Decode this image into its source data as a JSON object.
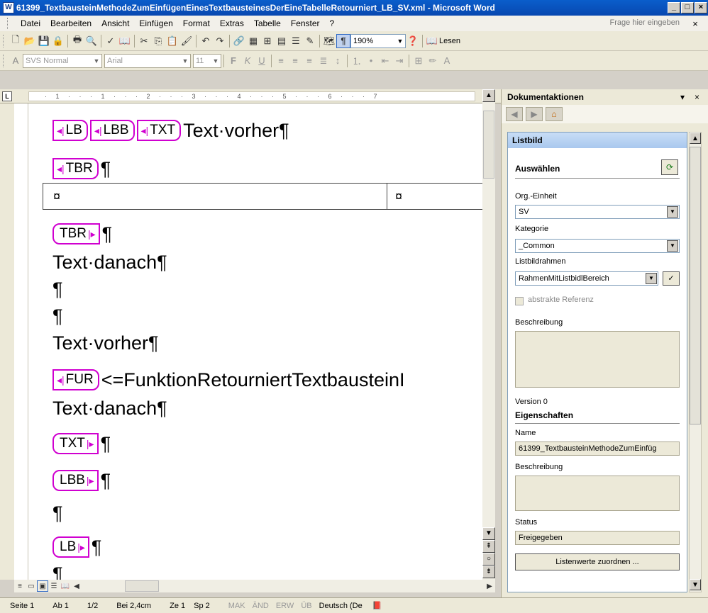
{
  "window": {
    "title": "61399_TextbausteinMethodeZumEinfügenEinesTextbausteinesDerEineTabelleRetourniert_LB_SV.xml - Microsoft Word",
    "min": "_",
    "max": "□",
    "close": "×"
  },
  "menu": {
    "items": [
      "Datei",
      "Bearbeiten",
      "Ansicht",
      "Einfügen",
      "Format",
      "Extras",
      "Tabelle",
      "Fenster",
      "?"
    ],
    "help_placeholder": "Frage hier eingeben",
    "close": "×"
  },
  "toolbar": {
    "zoom": "190%",
    "read": "Lesen"
  },
  "format": {
    "style": "SVS Normal",
    "font": "Arial",
    "size": "11"
  },
  "ruler": {
    "marks": "· 1 · · · 1 · · · 2 · · · 3 · · · 4 · · · 5 · · · 6 · · · 7"
  },
  "doc": {
    "tags": {
      "lb": "LB",
      "lbb": "LBB",
      "txt": "TXT",
      "tbr": "TBR",
      "fur": "FUR",
      "txt_end": "TXT",
      "lbb_end": "LBB",
      "lb_end": "LB",
      "tbr_end": "TBR"
    },
    "lines": {
      "l1": "Text·vorher¶",
      "l2": "¶",
      "cell1": "¤",
      "cell2": "¤",
      "l3": "¶",
      "l4": "Text·danach¶",
      "l5": "¶",
      "l6": "¶",
      "l7": "Text·vorher¶",
      "l8": "<=FunktionRetourniertTextbausteinI",
      "l9": "Text·danach¶",
      "l10": "¶",
      "l11": "¶",
      "l12": "¶",
      "l13": "¶",
      "l14": "¶"
    }
  },
  "status": {
    "page": "Seite 1",
    "section": "Ab 1",
    "pages": "1/2",
    "at": "Bei 2,4cm",
    "ln": "Ze 1",
    "col": "Sp 2",
    "mak": "MAK",
    "and": "ÄND",
    "erw": "ERW",
    "ub": "ÜB",
    "lang": "Deutsch (De"
  },
  "pane": {
    "title": "Dokumentaktionen",
    "section": "Listbild",
    "select_label": "Auswählen",
    "org_label": "Org.-Einheit",
    "org_value": "SV",
    "kat_label": "Kategorie",
    "kat_value": "_Common",
    "frame_label": "Listbildrahmen",
    "frame_value": "RahmenMitListbidlBereich",
    "abstract_label": "abstrakte Referenz",
    "desc_label": "Beschreibung",
    "version": "Version 0",
    "props_label": "Eigenschaften",
    "name_label": "Name",
    "name_value": "61399_TextbausteinMethodeZumEinfüg",
    "desc2_label": "Beschreibung",
    "status_label": "Status",
    "status_value": "Freigegeben",
    "assign_button": "Listenwerte zuordnen ..."
  }
}
